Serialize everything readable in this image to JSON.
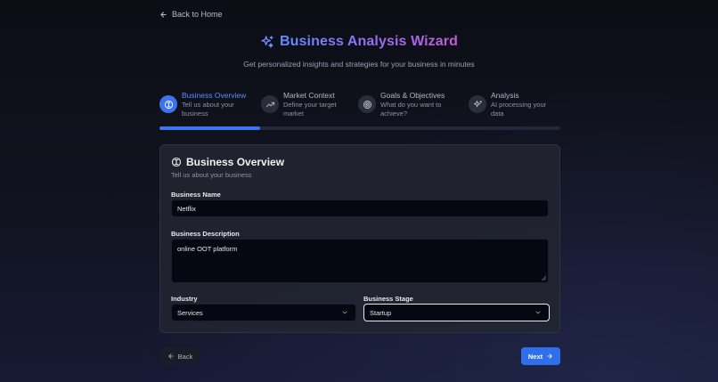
{
  "nav": {
    "back_home": "Back to Home"
  },
  "header": {
    "title": "Business Analysis Wizard",
    "subtitle": "Get personalized insights and strategies for your business in minutes"
  },
  "steps": [
    {
      "title": "Business Overview",
      "desc1": "Tell us about your",
      "desc2": "business",
      "icon": "info-icon",
      "active": true
    },
    {
      "title": "Market Context",
      "desc1": "Define your target",
      "desc2": "market",
      "icon": "trending-up-icon",
      "active": false
    },
    {
      "title": "Goals & Objectives",
      "desc1": "What do you want to",
      "desc2": "achieve?",
      "icon": "target-icon",
      "active": false
    },
    {
      "title": "Analysis",
      "desc1": "AI processing your",
      "desc2": "data",
      "icon": "sparkles-icon",
      "active": false
    }
  ],
  "progress": {
    "fraction": 0.25
  },
  "form": {
    "title": "Business Overview",
    "subtitle": "Tell us about your business",
    "business_name_label": "Business Name",
    "business_name_value": "Netflix",
    "business_description_label": "Business Description",
    "business_description_value": "online OOT platform",
    "industry_label": "Industry",
    "industry_value": "Services",
    "stage_label": "Business Stage",
    "stage_value": "Startup"
  },
  "buttons": {
    "back": "Back",
    "next": "Next"
  },
  "colors": {
    "accent": "#3b74f0",
    "card": "#222430",
    "field": "#050811"
  }
}
